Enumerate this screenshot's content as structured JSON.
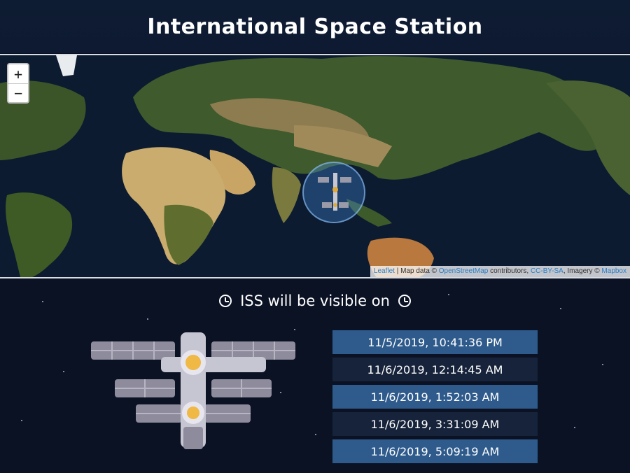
{
  "header": {
    "title": "International Space Station"
  },
  "map": {
    "zoom_in_label": "+",
    "zoom_out_label": "−",
    "attribution": {
      "leaflet": "Leaflet",
      "sep1": " | Map data © ",
      "osm": "OpenStreetMap",
      "contributors": " contributors, ",
      "license": "CC-BY-SA",
      "imagery": ", Imagery © ",
      "mapbox": "Mapbox"
    }
  },
  "visibility": {
    "heading": "ISS will be visible on",
    "passes": [
      "11/5/2019, 10:41:36 PM",
      "11/6/2019, 12:14:45 AM",
      "11/6/2019, 1:52:03 AM",
      "11/6/2019, 3:31:09 AM",
      "11/6/2019, 5:09:19 AM"
    ]
  },
  "colors": {
    "background": "#0b1224",
    "header_bg": "#0e1c33",
    "row_highlight": "#2f5b8c",
    "row_dark": "#16233a",
    "link": "#2a7fc6"
  },
  "icons": [
    "clock-icon",
    "iss-station-icon",
    "iss-map-marker-icon"
  ]
}
